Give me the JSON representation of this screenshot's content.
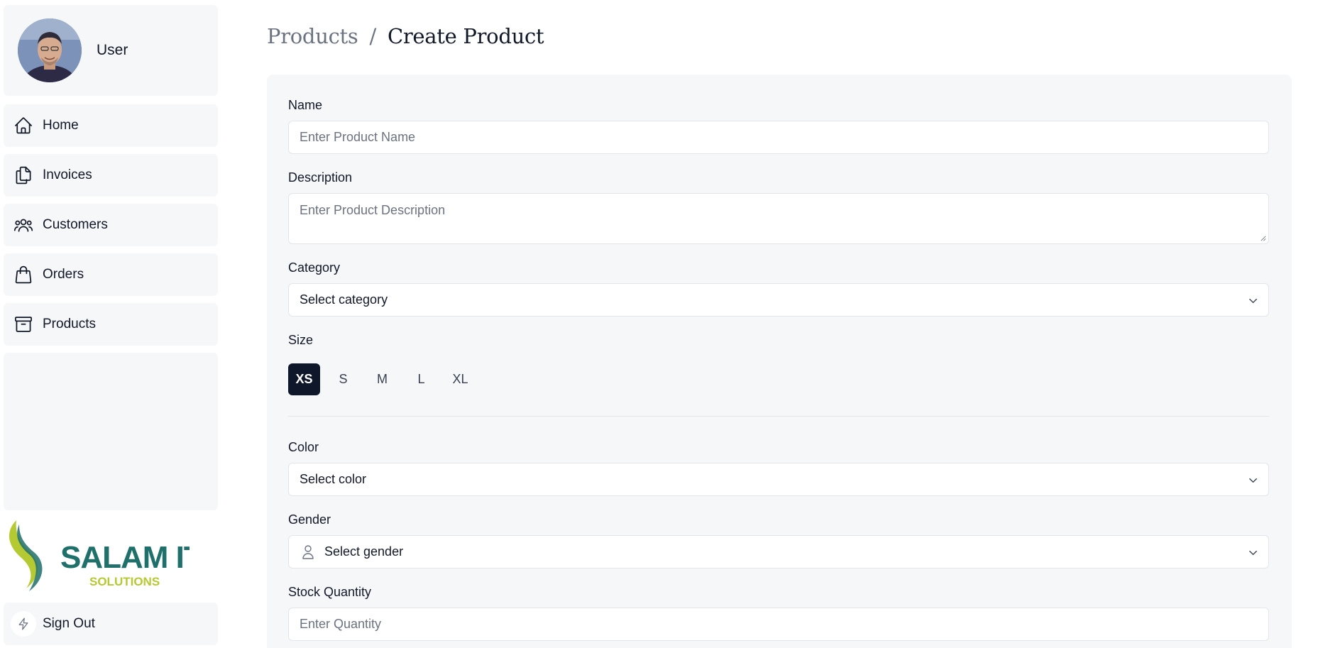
{
  "user": {
    "name": "User"
  },
  "nav": {
    "items": [
      {
        "label": "Home",
        "icon": "home-icon"
      },
      {
        "label": "Invoices",
        "icon": "documents-icon"
      },
      {
        "label": "Customers",
        "icon": "users-icon"
      },
      {
        "label": "Orders",
        "icon": "shopping-bag-icon"
      },
      {
        "label": "Products",
        "icon": "archive-box-icon"
      }
    ]
  },
  "logo": {
    "line1": "SALAM IT",
    "line2": "SOLUTIONS"
  },
  "signout": {
    "label": "Sign Out",
    "icon": "bolt-icon"
  },
  "breadcrumb": {
    "parent": "Products",
    "separator": "/",
    "current": "Create Product"
  },
  "form": {
    "name": {
      "label": "Name",
      "placeholder": "Enter Product Name"
    },
    "description": {
      "label": "Description",
      "placeholder": "Enter Product Description"
    },
    "category": {
      "label": "Category",
      "value": "Select category"
    },
    "size": {
      "label": "Size",
      "options": [
        "XS",
        "S",
        "M",
        "L",
        "XL"
      ],
      "selected": "XS"
    },
    "color": {
      "label": "Color",
      "value": "Select color"
    },
    "gender": {
      "label": "Gender",
      "value": "Select gender"
    },
    "stock": {
      "label": "Stock Quantity",
      "placeholder": "Enter Quantity"
    }
  },
  "colors": {
    "sidebar_bg": "#f6f7f9",
    "active_size_bg": "#0f172a",
    "logo_teal": "#1f6f6a",
    "logo_lime": "#b5c933"
  }
}
